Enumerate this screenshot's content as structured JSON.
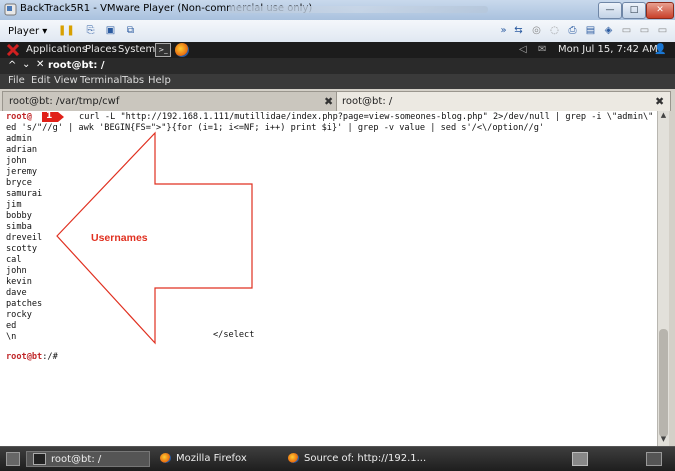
{
  "vmware": {
    "window_title": "BackTrack5R1 - VMware Player (Non-commercial use only)",
    "player_menu": "Player ▾",
    "toolbar_icons": [
      "pause-icon",
      "send-ctrl-alt-del-icon",
      "unity-icon",
      "fullscreen-icon"
    ],
    "right_icons": [
      "more-arrows-icon",
      "usb-icon",
      "cd-icon",
      "network-icon",
      "printer-icon",
      "devices-icon",
      "sound-icon",
      "display-icon",
      "message-icon",
      "vm-settings-icon"
    ]
  },
  "gnome_panel": {
    "applications": "Applications",
    "places": "Places",
    "system": "System",
    "clock": "Mon Jul 15,  7:42 AM"
  },
  "terminal": {
    "title": "root@bt: /",
    "menu": [
      "File",
      "Edit",
      "View",
      "Terminal",
      "Tabs",
      "Help"
    ],
    "tabs": [
      {
        "label": "root@bt: /var/tmp/cwf"
      },
      {
        "label": "root@bt: /"
      }
    ],
    "command_prompt_user": "root@",
    "command_line1": " curl -L \"http://192.168.1.111/mutillidae/index.php?page=view-someones-blog.php\" 2>/dev/null | grep -i \\\"admin\\\" | s",
    "command_line2": "ed 's/\"//g' | awk 'BEGIN{FS=\">\"}{for (i=1; i<=NF; i++) print $i}' | grep -v value | sed s'/<\\/option//g'",
    "usernames": [
      "admin",
      "adrian",
      "john",
      "jeremy",
      "bryce",
      "samurai",
      "jim",
      "bobby",
      "simba",
      "dreveil",
      "scotty",
      "cal",
      "john",
      "kevin",
      "dave",
      "patches",
      "rocky",
      "ed",
      "\\n"
    ],
    "select_close": "</select",
    "final_prompt_user": "root@bt",
    "final_prompt_rest": ":/#"
  },
  "annotation": {
    "step_number": "1",
    "arrow_label": "Usernames",
    "arrow_color": "#e03020",
    "badge_color": "#e02018"
  },
  "taskbar": {
    "items": [
      {
        "label": "root@bt: /"
      },
      {
        "label": "Mozilla Firefox"
      },
      {
        "label": "Source of: http://192.1..."
      }
    ]
  }
}
